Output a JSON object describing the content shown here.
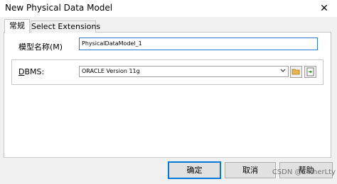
{
  "window": {
    "title": "New Physical Data Model",
    "close_glyph": "✕"
  },
  "tabs": [
    {
      "label": "常规",
      "active": true
    },
    {
      "label": "Select Extensions",
      "active": false
    }
  ],
  "general": {
    "model_name_label": "模型名称(M)",
    "model_name_value": "PhysicalDataModel_1",
    "dbms_label_mnemonic": "D",
    "dbms_label_rest": "BMS:",
    "dbms_value": "ORACLE Version 11g"
  },
  "icons": {
    "dropdown": "chevron-down-icon",
    "browse": "folder-icon",
    "properties": "properties-icon"
  },
  "buttons": {
    "ok": "确定",
    "cancel": "取消",
    "help": "帮助"
  },
  "watermark": "CSDN @EstherLty",
  "colors": {
    "accent": "#0078d7",
    "folder": "#e8b84a",
    "properties": "#2f8f2f"
  }
}
